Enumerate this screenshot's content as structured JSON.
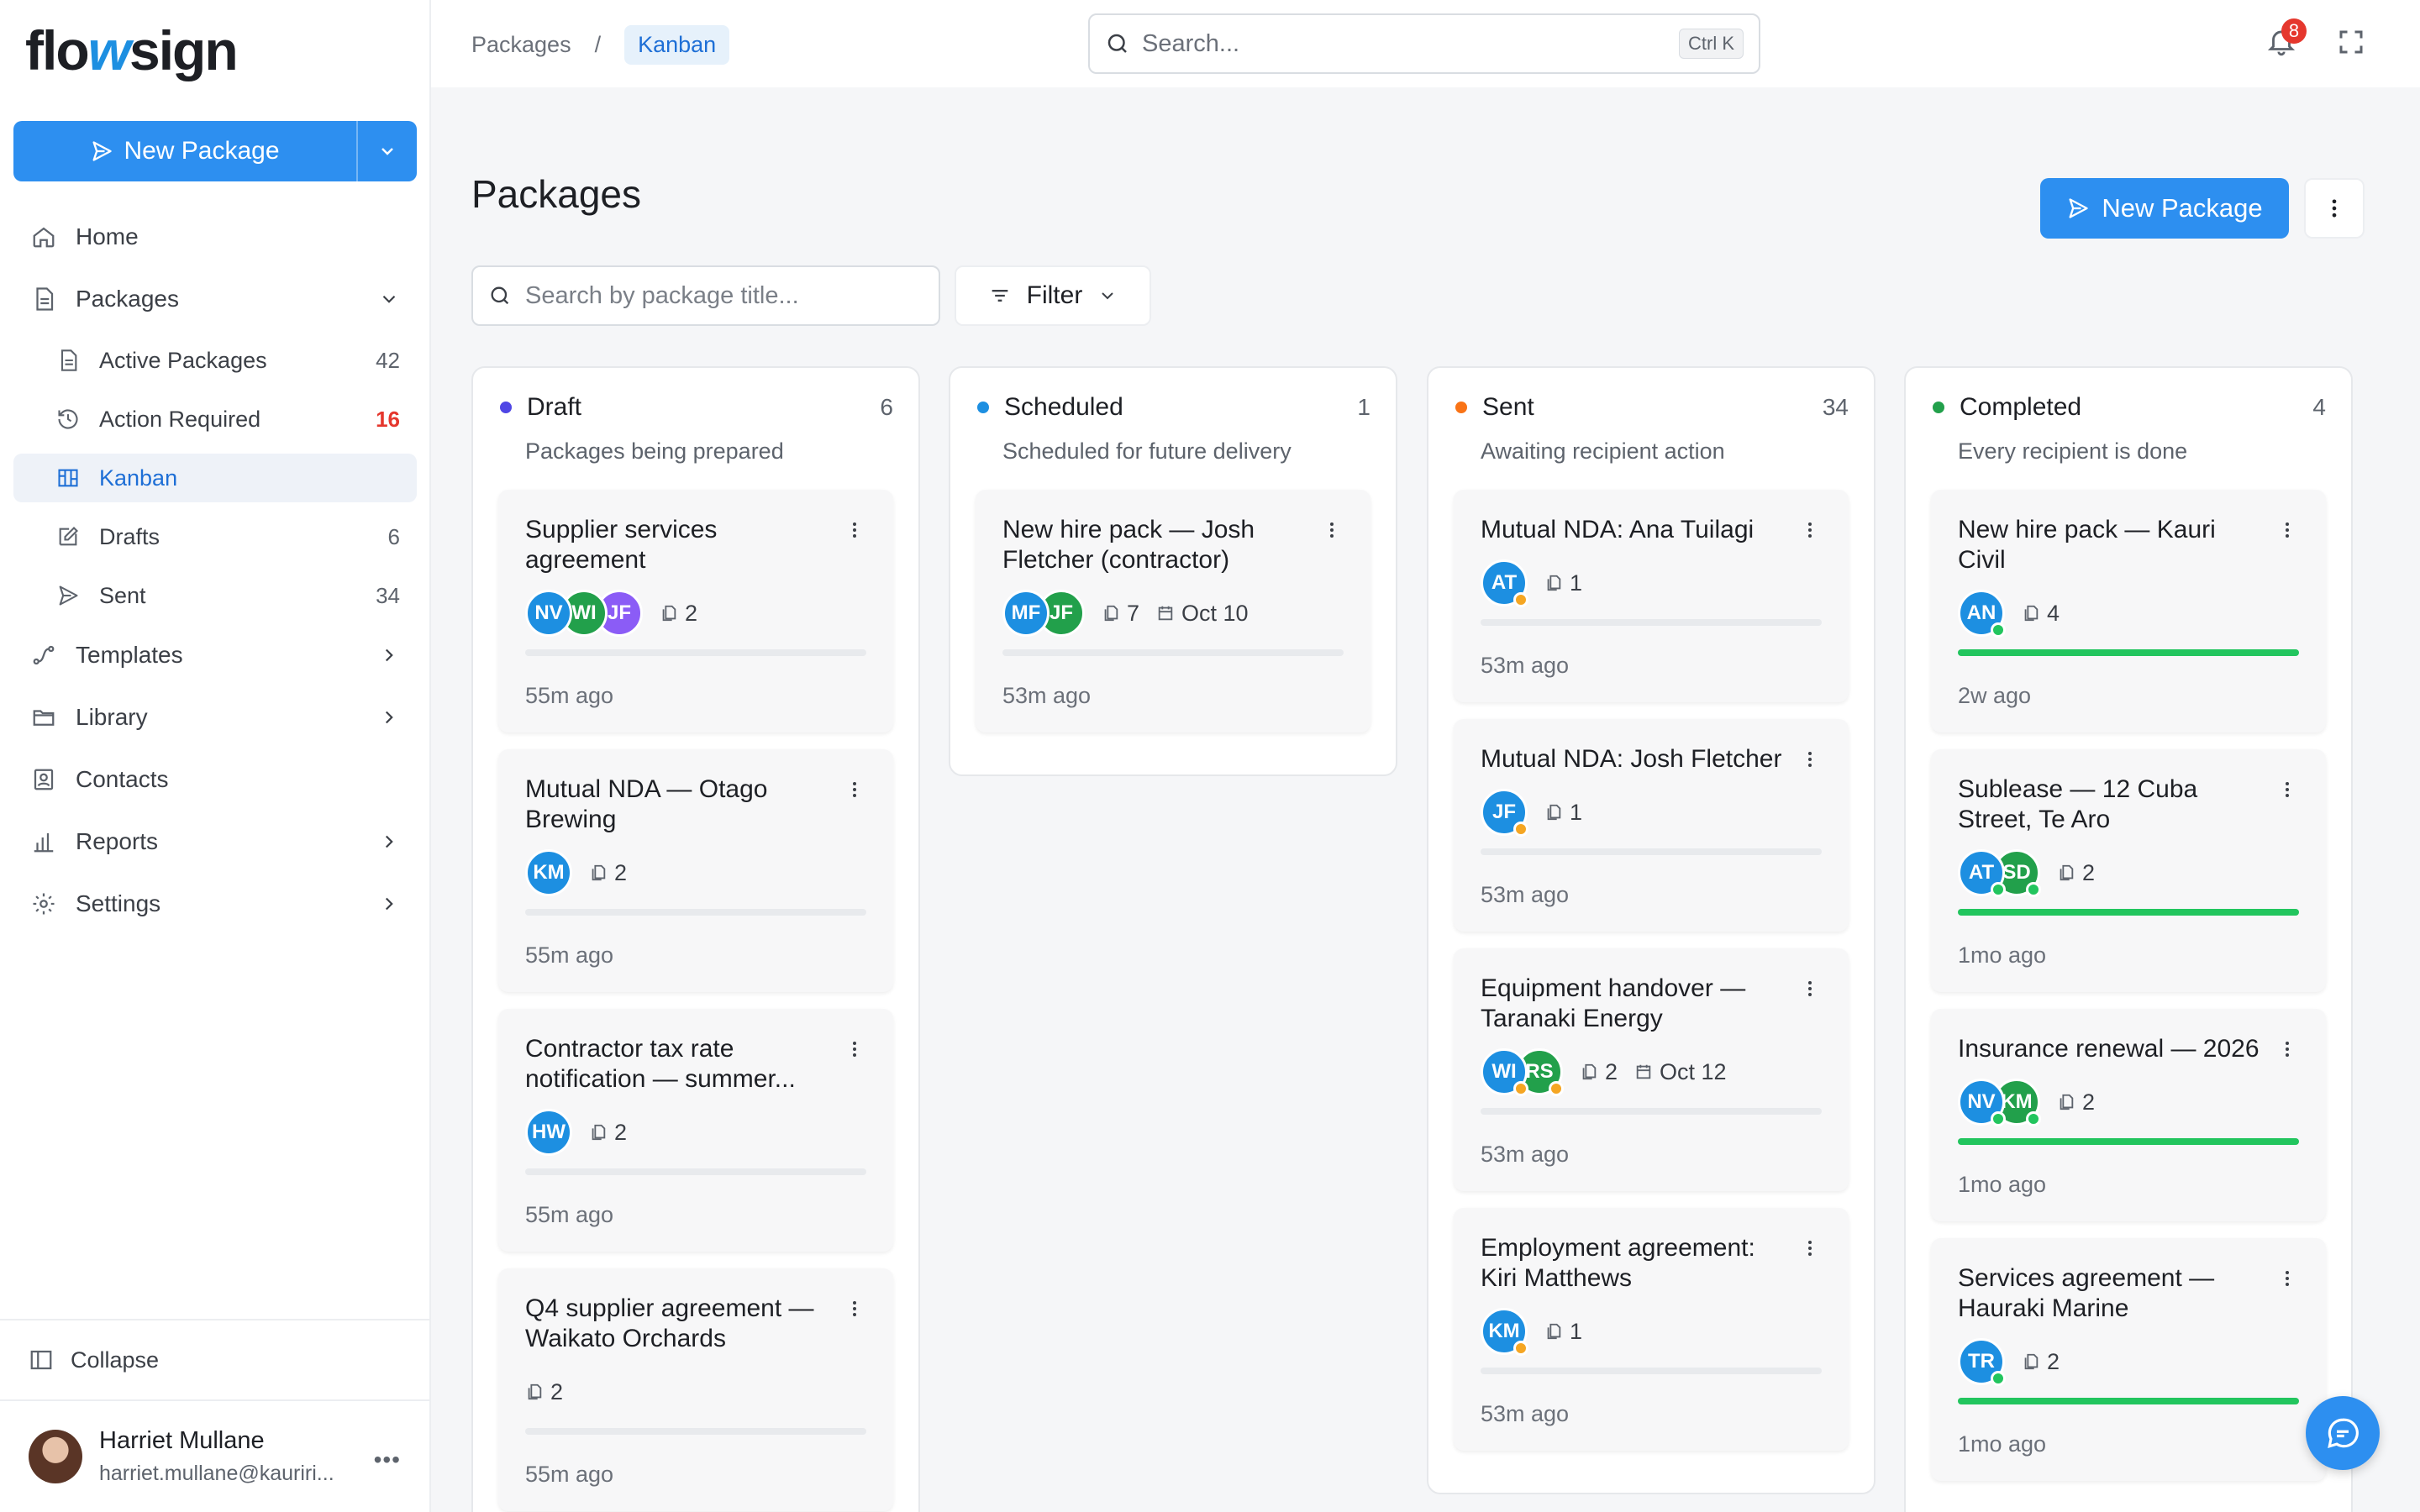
{
  "app": {
    "logo": {
      "left": "flo",
      "accent": "w",
      "right": "sign"
    },
    "new_package_label": "New Package"
  },
  "sidebar": {
    "items": [
      {
        "label": "Home",
        "icon": "home-icon"
      },
      {
        "label": "Packages",
        "icon": "document-icon",
        "expanded": true
      },
      {
        "label": "Active Packages",
        "count": "42",
        "icon": "document-icon"
      },
      {
        "label": "Action Required",
        "count": "16",
        "icon": "history-icon",
        "count_color": "#e5372d"
      },
      {
        "label": "Kanban",
        "icon": "kanban-icon",
        "active": true
      },
      {
        "label": "Drafts",
        "count": "6",
        "icon": "edit-icon"
      },
      {
        "label": "Sent",
        "count": "34",
        "icon": "send-icon"
      },
      {
        "label": "Templates",
        "icon": "route-icon"
      },
      {
        "label": "Library",
        "icon": "folder-icon"
      },
      {
        "label": "Contacts",
        "icon": "contact-icon"
      },
      {
        "label": "Reports",
        "icon": "bar-chart-icon"
      },
      {
        "label": "Settings",
        "icon": "gear-icon"
      }
    ],
    "collapse_label": "Collapse",
    "user": {
      "name": "Harriet Mullane",
      "email": "harriet.mullane@kauriri..."
    }
  },
  "topbar": {
    "breadcrumb": [
      "Packages",
      "Kanban"
    ],
    "search_placeholder": "Search...",
    "search_shortcut": "Ctrl K",
    "notification_count": "8"
  },
  "main": {
    "title": "Packages",
    "new_package_label": "New Package",
    "search_placeholder": "Search by package title...",
    "filter_label": "Filter"
  },
  "columns": [
    {
      "name": "Draft",
      "count": "6",
      "description": "Packages being prepared",
      "dot_color": "#4f46e5",
      "cards": [
        {
          "title": "Supplier services agreement",
          "avatars": [
            {
              "initials": "NV",
              "color": "#1d8fe1"
            },
            {
              "initials": "WI",
              "color": "#22a04b"
            },
            {
              "initials": "JF",
              "color": "#8b5cf6"
            }
          ],
          "docs": "2",
          "time": "55m ago"
        },
        {
          "title": "Mutual NDA — Otago Brewing",
          "avatars": [
            {
              "initials": "KM",
              "color": "#1d8fe1"
            }
          ],
          "docs": "2",
          "time": "55m ago"
        },
        {
          "title": "Contractor tax rate notification — summer...",
          "avatars": [
            {
              "initials": "HW",
              "color": "#1d8fe1"
            }
          ],
          "docs": "2",
          "time": "55m ago"
        },
        {
          "title": "Q4 supplier agreement — Waikato Orchards",
          "avatars": [],
          "docs": "2",
          "time": "55m ago"
        }
      ]
    },
    {
      "name": "Scheduled",
      "count": "1",
      "description": "Scheduled for future delivery",
      "dot_color": "#1d8fe1",
      "cards": [
        {
          "title": "New hire pack — Josh Fletcher (contractor)",
          "avatars": [
            {
              "initials": "MF",
              "color": "#1d8fe1"
            },
            {
              "initials": "JF",
              "color": "#22a04b"
            }
          ],
          "docs": "7",
          "date": "Oct 10",
          "time": "53m ago"
        }
      ]
    },
    {
      "name": "Sent",
      "count": "34",
      "description": "Awaiting recipient action",
      "dot_color": "#f97316",
      "cards": [
        {
          "title": "Mutual NDA: Ana Tuilagi",
          "avatars": [
            {
              "initials": "AT",
              "color": "#1d8fe1",
              "status": "#f5a623"
            }
          ],
          "docs": "1",
          "time": "53m ago"
        },
        {
          "title": "Mutual NDA: Josh Fletcher",
          "avatars": [
            {
              "initials": "JF",
              "color": "#1d8fe1",
              "status": "#f5a623"
            }
          ],
          "docs": "1",
          "time": "53m ago"
        },
        {
          "title": "Equipment handover — Taranaki Energy",
          "avatars": [
            {
              "initials": "WI",
              "color": "#1d8fe1",
              "status": "#f5a623"
            },
            {
              "initials": "RS",
              "color": "#22a04b",
              "status": "#f5a623"
            }
          ],
          "docs": "2",
          "date": "Oct 12",
          "time": "53m ago"
        },
        {
          "title": "Employment agreement: Kiri Matthews",
          "avatars": [
            {
              "initials": "KM",
              "color": "#1d8fe1",
              "status": "#f5a623"
            }
          ],
          "docs": "1",
          "time": "53m ago"
        }
      ]
    },
    {
      "name": "Completed",
      "count": "4",
      "description": "Every recipient is done",
      "dot_color": "#22a04b",
      "cards": [
        {
          "title": "New hire pack — Kauri Civil",
          "avatars": [
            {
              "initials": "AN",
              "color": "#1d8fe1",
              "status": "#22c55e"
            }
          ],
          "docs": "4",
          "progress": 1,
          "time": "2w ago"
        },
        {
          "title": "Sublease — 12 Cuba Street, Te Aro",
          "avatars": [
            {
              "initials": "AT",
              "color": "#1d8fe1",
              "status": "#22c55e"
            },
            {
              "initials": "SD",
              "color": "#22a04b",
              "status": "#22c55e"
            }
          ],
          "docs": "2",
          "progress": 1,
          "time": "1mo ago"
        },
        {
          "title": "Insurance renewal — 2026",
          "avatars": [
            {
              "initials": "NV",
              "color": "#1d8fe1",
              "status": "#22c55e"
            },
            {
              "initials": "KM",
              "color": "#22a04b",
              "status": "#22c55e"
            }
          ],
          "docs": "2",
          "progress": 1,
          "time": "1mo ago"
        },
        {
          "title": "Services agreement — Hauraki Marine",
          "avatars": [
            {
              "initials": "TR",
              "color": "#1d8fe1",
              "status": "#22c55e"
            }
          ],
          "docs": "2",
          "progress": 1,
          "time": "1mo ago"
        }
      ]
    }
  ]
}
